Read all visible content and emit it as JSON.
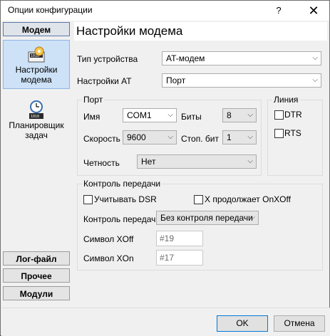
{
  "window": {
    "title": "Опции конфигурации",
    "help": "?",
    "close": "✕"
  },
  "nav": {
    "modem_header": "Модем",
    "modem_tile": {
      "line1": "Настройки",
      "line2": "модема"
    },
    "scheduler_tile": {
      "line1": "Планировщик",
      "line2": "задач"
    },
    "log_header": "Лог-файл",
    "other_header": "Прочее",
    "modules_header": "Модули"
  },
  "page": {
    "heading": "Настройки модема",
    "device_type": {
      "label": "Тип устройства",
      "value": "AT-модем"
    },
    "at_settings": {
      "label": "Настройки AT",
      "value": "Порт"
    },
    "port": {
      "title": "Порт",
      "name": {
        "label": "Имя",
        "value": "COM1"
      },
      "bits": {
        "label": "Биты",
        "value": "8"
      },
      "speed": {
        "label": "Скорость",
        "value": "9600"
      },
      "stopbits": {
        "label": "Стоп. бит",
        "value": "1"
      },
      "parity": {
        "label": "Четность",
        "value": "Нет"
      }
    },
    "line": {
      "title": "Линия",
      "dtr": "DTR",
      "rts": "RTS"
    },
    "flow": {
      "title": "Контроль передачи",
      "dsr": "Учитывать DSR",
      "xonxoff": "X продолжает OnXOff",
      "control": {
        "label": "Контроль передачи",
        "value": "Без контроля передачи"
      },
      "xoff": {
        "label": "Символ XOff",
        "value": "#19"
      },
      "xon": {
        "label": "Символ XOn",
        "value": "#17"
      }
    }
  },
  "buttons": {
    "ok": "OK",
    "cancel": "Отмена"
  }
}
